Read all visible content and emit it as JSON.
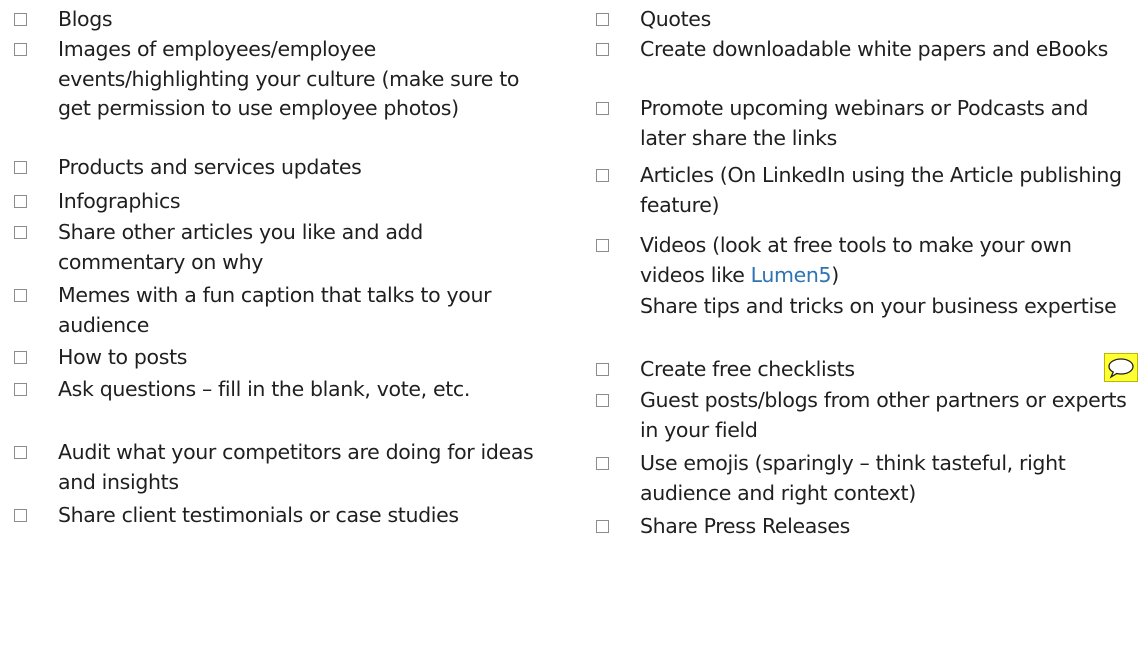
{
  "left_column": [
    {
      "text": "Blogs",
      "checkbox": true
    },
    {
      "text": "Images of employees/employee events/highlighting your culture (make sure to get permission to use employee photos)",
      "checkbox": true
    },
    {
      "text": "Products and services updates",
      "checkbox": true
    },
    {
      "text": "Infographics",
      "checkbox": true
    },
    {
      "text": "Share other articles you like and add commentary on why",
      "checkbox": true
    },
    {
      "text": "Memes with a fun caption that talks to your audience",
      "checkbox": true
    },
    {
      "text": "How to posts",
      "checkbox": true
    },
    {
      "text": "Ask questions – fill in the blank, vote, etc.",
      "checkbox": true
    },
    {
      "text": "Audit what your competitors are doing for ideas and insights",
      "checkbox": true
    },
    {
      "text": "Share client testimonials or case studies",
      "checkbox": true
    }
  ],
  "right_column": [
    {
      "text": "Quotes",
      "checkbox": true
    },
    {
      "text": "Create downloadable white papers and eBooks",
      "checkbox": true
    },
    {
      "text": "Promote upcoming webinars or Podcasts and later share the links",
      "checkbox": true
    },
    {
      "text": "Articles (On LinkedIn using the Article publishing feature)",
      "checkbox": true
    },
    {
      "text_before": "Videos (look at free tools to make your own videos like ",
      "link": "Lumen5",
      "text_after": ")",
      "checkbox": true
    },
    {
      "text": "Share tips and tricks on your business expertise",
      "checkbox": false
    },
    {
      "text": "Create free checklists",
      "checkbox": true
    },
    {
      "text": "Guest posts/blogs from other partners or experts in your field",
      "checkbox": true
    },
    {
      "text": "Use emojis (sparingly – think tasteful, right audience and right context)",
      "checkbox": true
    },
    {
      "text": "Share Press Releases",
      "checkbox": true
    }
  ],
  "colors": {
    "text": "#1f1f1f",
    "link": "#2e74b5",
    "checkbox_border": "#8c8c8c",
    "comment_fill": "#ffff33"
  },
  "comment_icon": "speech-bubble-icon"
}
